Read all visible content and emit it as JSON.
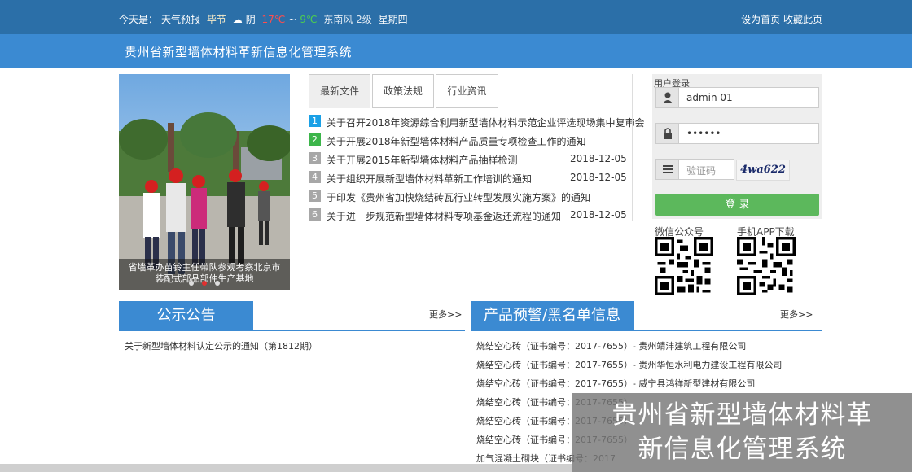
{
  "topbar": {
    "weather_prefix": "今天是：",
    "weather_label": "天气预报",
    "city": "毕节",
    "condition": "阴",
    "temp_high": "17℃",
    "temp_sep": "~",
    "temp_low": "9℃",
    "wind": "东南风 2级",
    "weekday": "星期四",
    "link_home": "设为首页",
    "link_fav": "收藏此页"
  },
  "header": {
    "title": "贵州省新型墙体材料革新信息化管理系统"
  },
  "slider": {
    "caption_line1": "省墙革办苗铃主任带队参观考察北京市",
    "caption_line2": "装配式部品部件生产基地"
  },
  "tabs": [
    {
      "label": "最新文件",
      "active": true
    },
    {
      "label": "政策法规",
      "active": false
    },
    {
      "label": "行业资讯",
      "active": false
    }
  ],
  "news": [
    {
      "num": "1",
      "title": "关于召开2018年资源综合利用新型墙体材料示范企业评选现场集中复审会",
      "date": "",
      "color": "#1aa0e6"
    },
    {
      "num": "2",
      "title": "关于开展2018年新型墙体材料产品质量专项检查工作的通知",
      "date": "",
      "color": "#3cb54a"
    },
    {
      "num": "3",
      "title": "关于开展2015年新型墙体材料产品抽样检测",
      "date": "2018-12-05",
      "color": "#a7a7a7"
    },
    {
      "num": "4",
      "title": "关于组织开展新型墙体材料革新工作培训的通知",
      "date": "2018-12-05",
      "color": "#a7a7a7"
    },
    {
      "num": "5",
      "title": "于印发《贵州省加快烧结砖瓦行业转型发展实施方案》的通知",
      "date": "",
      "color": "#a7a7a7"
    },
    {
      "num": "6",
      "title": "关于进一步规范新型墙体材料专项基金返还流程的通知",
      "date": "2018-12-05",
      "color": "#a7a7a7"
    }
  ],
  "login": {
    "label": "用户登录",
    "username": "admin 01",
    "password": "••••••",
    "captcha_placeholder": "验证码",
    "captcha_text": "4wa622",
    "button": "登 录"
  },
  "qr": {
    "wechat_label": "微信公众号",
    "app_label": "手机APP下载"
  },
  "notice": {
    "heading": "公示公告",
    "more": "更多>>",
    "items": [
      "关于新型墙体材料认定公示的通知（第1812期）"
    ]
  },
  "warnings": {
    "heading": "产品预警/黑名单信息",
    "more": "更多>>",
    "items": [
      "烧结空心砖（证书编号：2017-7655）- 贵州靖沣建筑工程有限公司",
      "烧结空心砖（证书编号：2017-7655）- 贵州华恒水利电力建设工程有限公司",
      "烧结空心砖（证书编号：2017-7655）- 威宁县鸿祥新型建材有限公司",
      "烧结空心砖（证书编号：2017-7655）",
      "烧结空心砖（证书编号：2017-7655）",
      "烧结空心砖（证书编号：2017-7655）",
      "加气混凝土砌块（证书编号：2017"
    ]
  },
  "overlay": {
    "line1": "贵州省新型墙体材料革",
    "line2": "新信息化管理系统"
  }
}
